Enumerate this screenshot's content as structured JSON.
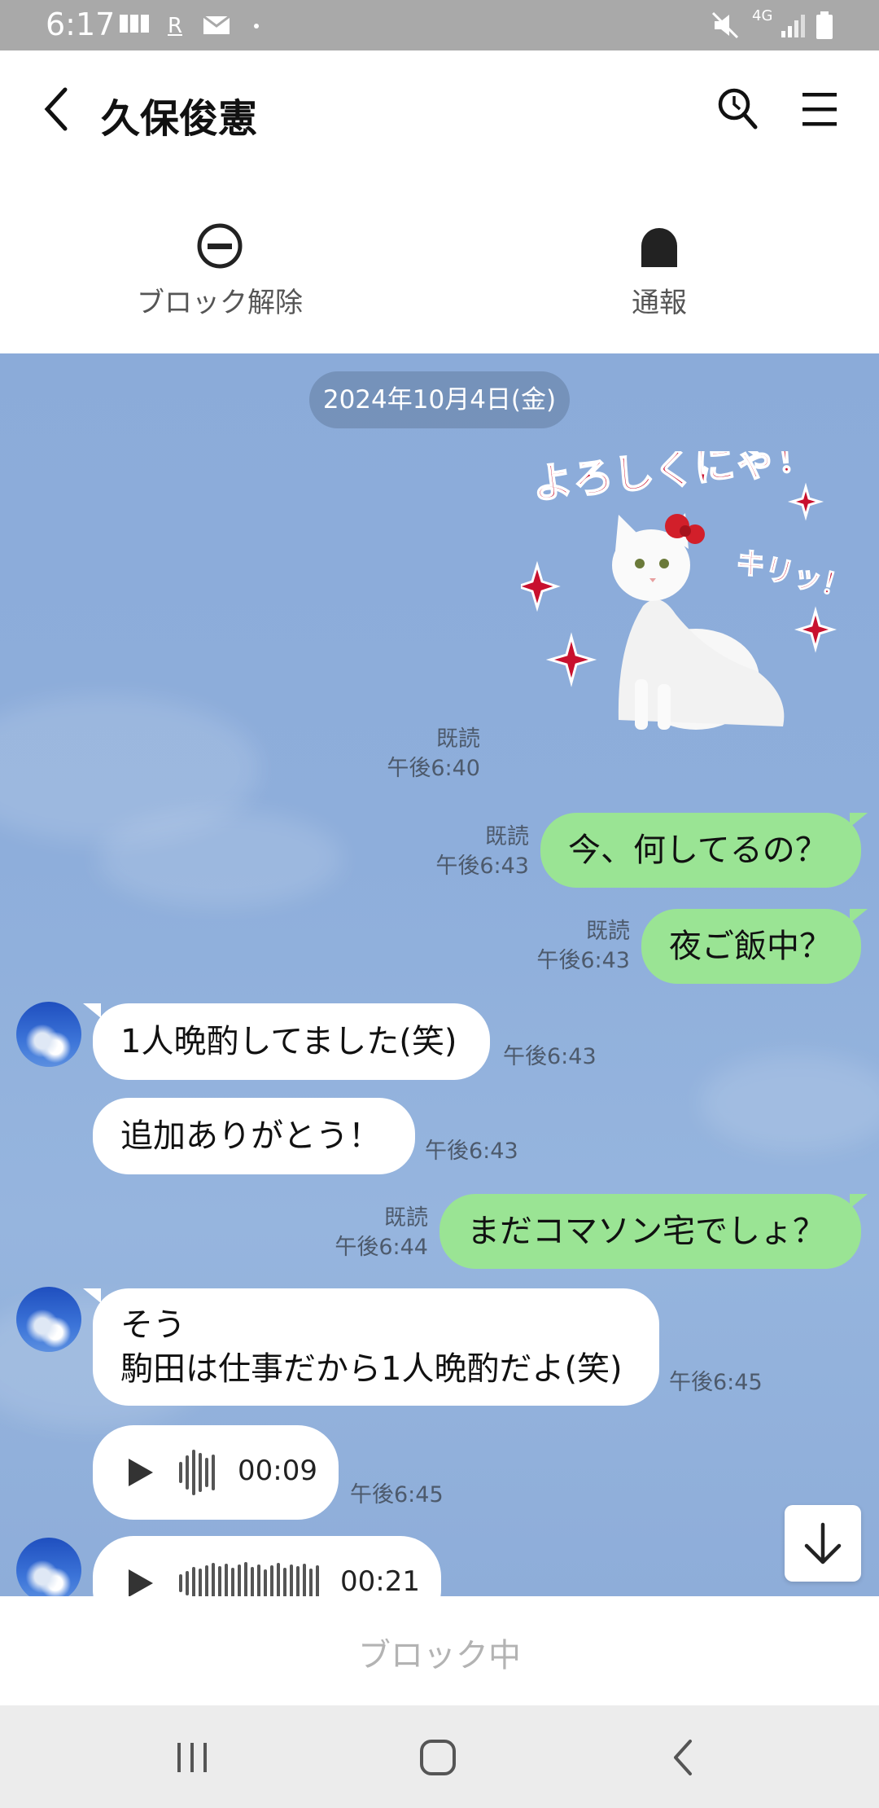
{
  "status_bar": {
    "time": "6:17",
    "icons": [
      "notification-icon",
      "rakuten-icon",
      "mail-icon",
      "dot-icon",
      "mute-icon",
      "network-4g-icon",
      "signal-icon",
      "battery-icon"
    ],
    "network": "4G"
  },
  "header": {
    "title": "久保俊憲",
    "icons": [
      "back-icon",
      "search-icon",
      "menu-icon"
    ]
  },
  "actions": {
    "unblock_label": "ブロック解除",
    "report_label": "通報"
  },
  "chat": {
    "date": "2024年10月4日(金)",
    "sticker": {
      "text_main": "よろしくにゃ！",
      "text_side": "キリッ！",
      "read": "既読",
      "time": "午後6:40"
    },
    "messages": [
      {
        "from": "me",
        "text": "今、何してるの？",
        "read": "既読",
        "time": "午後6:43"
      },
      {
        "from": "me",
        "text": "夜ご飯中？",
        "read": "既読",
        "time": "午後6:43"
      },
      {
        "from": "them",
        "text": "1人晩酌してました(笑)",
        "time": "午後6:43"
      },
      {
        "from": "them",
        "text": "追加ありがとう！",
        "time": "午後6:43"
      },
      {
        "from": "me",
        "text": "まだコマソン宅でしょ？",
        "read": "既読",
        "time": "午後6:44"
      },
      {
        "from": "them",
        "line1": "そう",
        "line2": "駒田は仕事だから1人晩酌だよ(笑)",
        "time": "午後6:45"
      },
      {
        "from": "them",
        "voice": true,
        "duration": "00:09",
        "time": "午後6:45"
      },
      {
        "from": "them",
        "voice": true,
        "duration": "00:21"
      }
    ]
  },
  "block_bar": {
    "text": "ブロック中"
  },
  "colors": {
    "my_bubble": "#9ae494",
    "their_bubble": "#ffffff",
    "chat_bg": "#8eaedb",
    "status_bar": "#a9a9a9"
  }
}
